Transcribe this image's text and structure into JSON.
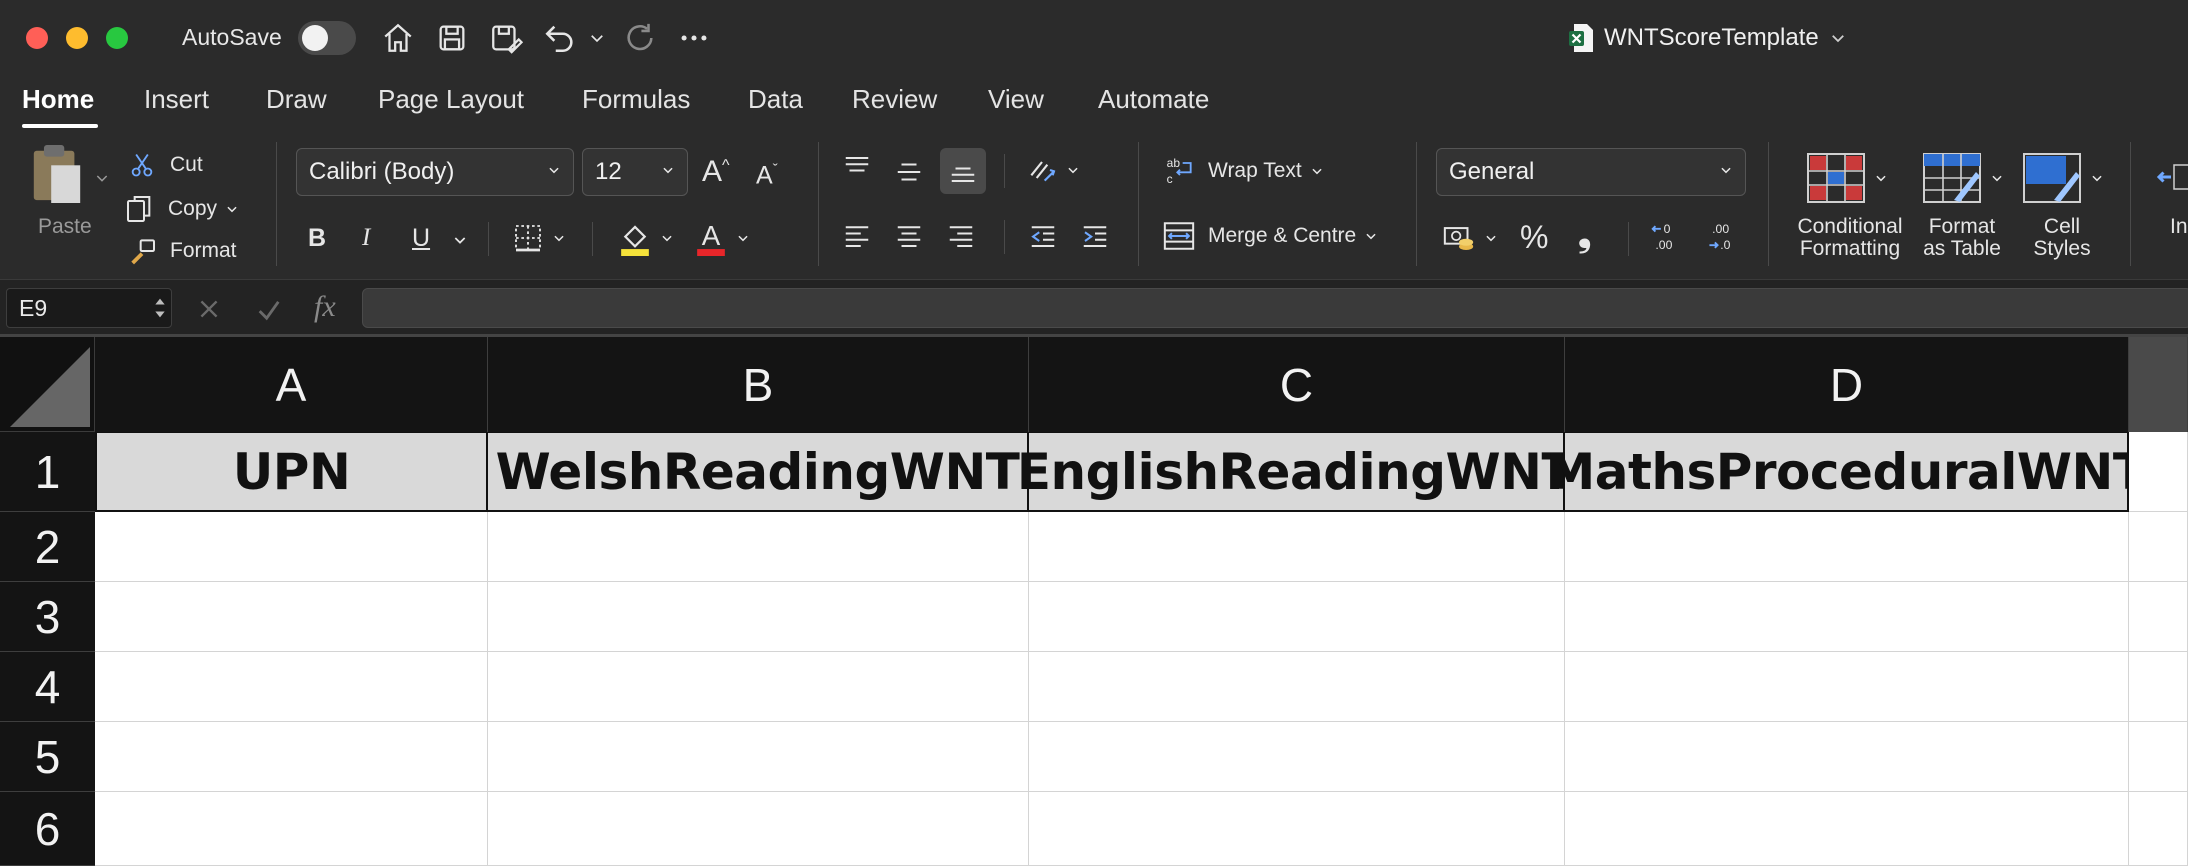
{
  "titlebar": {
    "autosave_label": "AutoSave",
    "document_title": "WNTScoreTemplate"
  },
  "tabs": [
    {
      "label": "Home",
      "active": true
    },
    {
      "label": "Insert"
    },
    {
      "label": "Draw"
    },
    {
      "label": "Page Layout"
    },
    {
      "label": "Formulas"
    },
    {
      "label": "Data"
    },
    {
      "label": "Review"
    },
    {
      "label": "View"
    },
    {
      "label": "Automate"
    }
  ],
  "ribbon": {
    "clipboard": {
      "paste": "Paste",
      "cut": "Cut",
      "copy": "Copy",
      "format": "Format"
    },
    "font": {
      "name": "Calibri (Body)",
      "size": "12",
      "bold": "B",
      "italic": "I",
      "underline": "U"
    },
    "alignment": {
      "wrap_text": "Wrap Text",
      "merge": "Merge & Centre"
    },
    "number": {
      "format": "General",
      "percent": "%",
      "comma": "❟"
    },
    "styles": {
      "conditional": [
        "Conditional",
        "Formatting"
      ],
      "format_table": [
        "Format",
        "as Table"
      ],
      "cell_styles": [
        "Cell",
        "Styles"
      ],
      "insert_partial": "In"
    }
  },
  "formula_bar": {
    "name_box": "E9",
    "fx": "fx",
    "formula": ""
  },
  "sheet": {
    "columns": [
      "A",
      "B",
      "C",
      "D"
    ],
    "rows": [
      "1",
      "2",
      "3",
      "4",
      "5",
      "6"
    ],
    "header_row": [
      "UPN",
      "WelshReadingWNT",
      "EnglishReadingWNT",
      "MathsProceduralWNT"
    ]
  },
  "colors": {
    "titlebar_bg": "#2b2b2b",
    "grid_header_bg": "#141414",
    "header_cell_fill": "#d9d9d9",
    "excel_green": "#1d6f42"
  }
}
